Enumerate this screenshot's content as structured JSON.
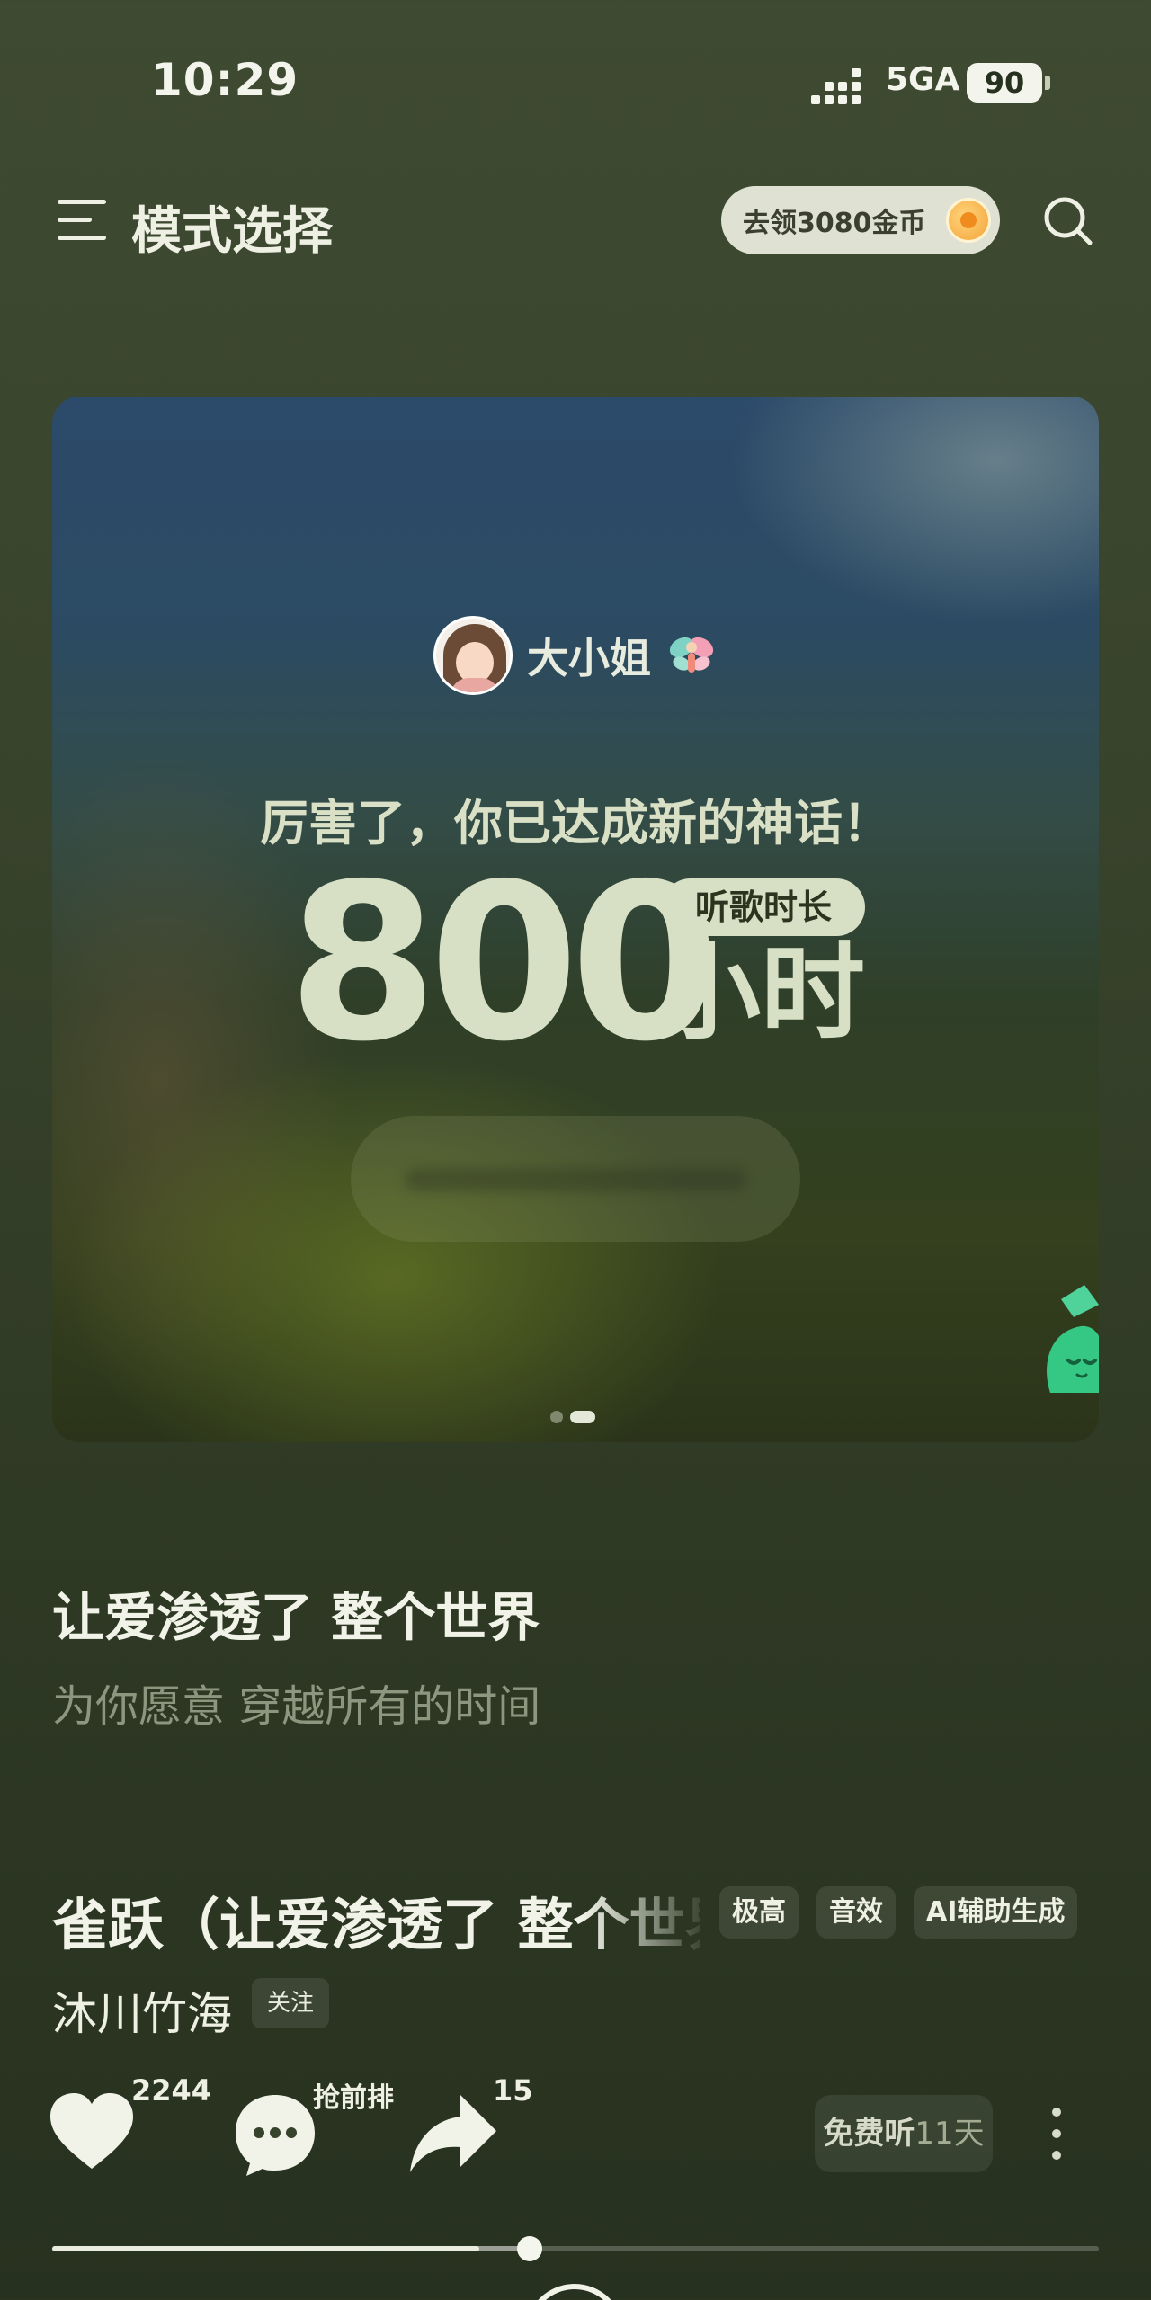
{
  "status_bar": {
    "time": "10:29",
    "network": "5GA",
    "battery": "90"
  },
  "header": {
    "title": "模式选择",
    "coin_label": "去领3080金币",
    "icons": [
      "menu-icon",
      "coin-icon",
      "search-icon"
    ]
  },
  "banner": {
    "username": "大小姐",
    "achievement_text": "厉害了，你已达成新的神话！",
    "hours_value": "800",
    "badge": "听歌时长",
    "unit": "小时",
    "active_page": 2,
    "page_count": 2
  },
  "lyrics": {
    "current_line": "让爱渗透了 整个世界",
    "next_line": "为你愿意 穿越所有的时间"
  },
  "song": {
    "title": "雀跃（让爱渗透了 整个世界）",
    "tags": [
      "极高",
      "音效",
      "AI辅助生成"
    ],
    "artist": "沐川竹海",
    "follow_label": "关注"
  },
  "actions": {
    "like_count": "2244",
    "comment_label": "抢前排",
    "share_count": "15",
    "free_listen_label": "免费听",
    "free_listen_days": "11天"
  },
  "playback": {
    "progress_fraction": 0.456,
    "buffered_fraction": 0.408
  },
  "colors": {
    "background": "#38432c",
    "text_primary": "#f1f3e8",
    "text_secondary": "#8d967e",
    "accent_number": "#d7e0c4",
    "coin_pill": "#dfe2d2"
  }
}
